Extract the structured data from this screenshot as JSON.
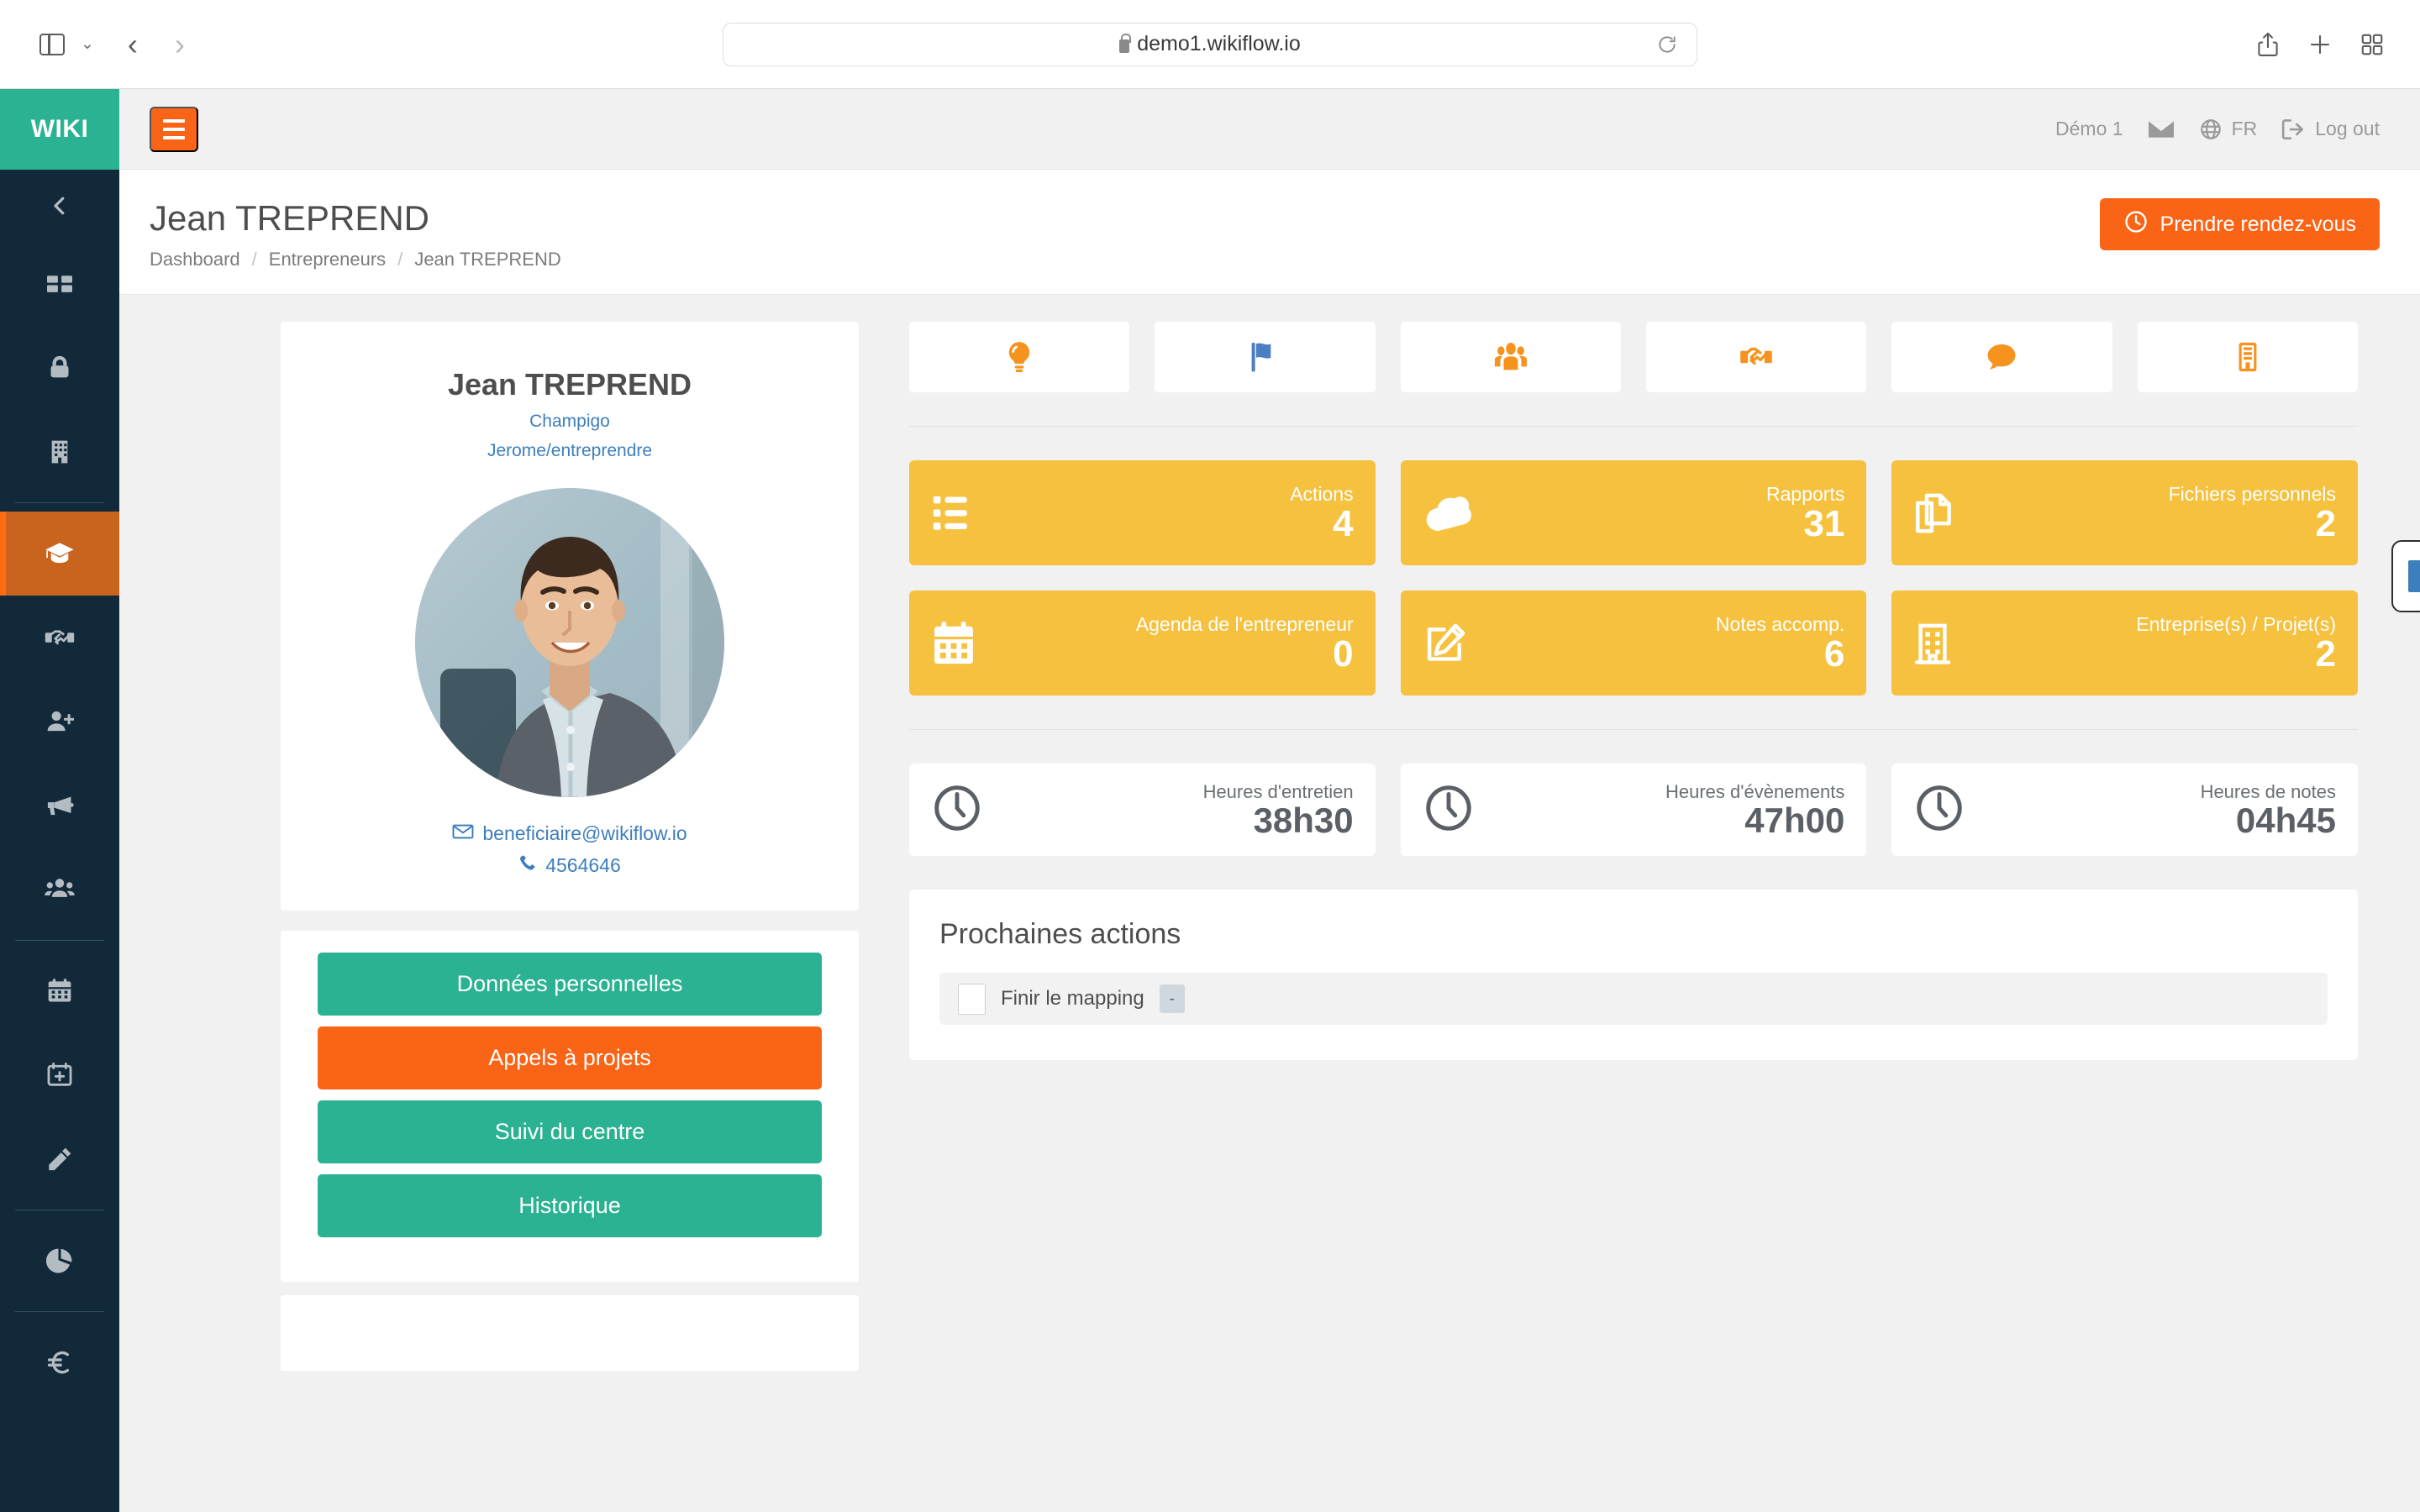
{
  "browser": {
    "url": "demo1.wikiflow.io",
    "icons": {
      "sidebar_toggle": "sidebar-toggle-icon",
      "tab_overview_chevron": "chevron-down-icon",
      "back": "back-arrow-icon",
      "forward": "forward-arrow-icon",
      "shield": "privacy-shield-icon",
      "lock": "lock-icon",
      "reload": "reload-icon",
      "share": "share-icon",
      "new_tab": "plus-icon",
      "tab_grid": "tab-overview-icon"
    },
    "back_glyph": "‹",
    "forward_glyph": "›",
    "chevron_glyph": "⌄"
  },
  "sidebar": {
    "brand": "WIKI",
    "items": [
      {
        "name": "collapse",
        "icon": "chevron-left-icon",
        "active": false,
        "divider_after": false
      },
      {
        "name": "dashboard",
        "icon": "grid-icon",
        "active": false,
        "divider_after": false
      },
      {
        "name": "security",
        "icon": "lock-icon",
        "active": false,
        "divider_after": false
      },
      {
        "name": "companies",
        "icon": "building-icon",
        "active": false,
        "divider_after": true
      },
      {
        "name": "entrepreneurs",
        "icon": "graduation-cap-icon",
        "active": true,
        "divider_after": false
      },
      {
        "name": "partners",
        "icon": "handshake-icon",
        "active": false,
        "divider_after": false
      },
      {
        "name": "add-user",
        "icon": "user-plus-icon",
        "active": false,
        "divider_after": false
      },
      {
        "name": "announcements",
        "icon": "megaphone-icon",
        "active": false,
        "divider_after": false
      },
      {
        "name": "teams",
        "icon": "users-icon",
        "active": false,
        "divider_after": true
      },
      {
        "name": "calendar",
        "icon": "calendar-icon",
        "active": false,
        "divider_after": false
      },
      {
        "name": "add-event",
        "icon": "calendar-plus-icon",
        "active": false,
        "divider_after": false
      },
      {
        "name": "notes",
        "icon": "pencil-icon",
        "active": false,
        "divider_after": true
      },
      {
        "name": "statistics",
        "icon": "pie-chart-icon",
        "active": false,
        "divider_after": true
      },
      {
        "name": "finance",
        "icon": "euro-icon",
        "active": false,
        "divider_after": false
      }
    ]
  },
  "topbar": {
    "menu_icon": "hamburger-menu-icon",
    "account": "Démo 1",
    "mail_icon": "envelope-icon",
    "globe_icon": "globe-icon",
    "language": "FR",
    "logout_icon": "logout-icon",
    "logout": "Log out"
  },
  "page": {
    "title": "Jean TREPREND",
    "breadcrumb": [
      {
        "label": "Dashboard"
      },
      {
        "label": "Entrepreneurs"
      },
      {
        "label": "Jean TREPREND"
      }
    ],
    "breadcrumb_separator": "/",
    "appointment_button": "Prendre rendez-vous",
    "appointment_icon": "clock-icon"
  },
  "profile": {
    "name": "Jean TREPREND",
    "organization": "Champigo",
    "program": "Jerome/entreprendre",
    "email": "beneficiaire@wikiflow.io",
    "email_icon": "envelope-icon",
    "phone": "4564646",
    "phone_icon": "phone-icon",
    "avatar_icon": "profile-photo",
    "actions": [
      {
        "label": "Données personnelles",
        "style": "green"
      },
      {
        "label": "Appels à projets",
        "style": "orange"
      },
      {
        "label": "Suivi du centre",
        "style": "green"
      },
      {
        "label": "Historique",
        "style": "green"
      }
    ]
  },
  "tiles": [
    {
      "name": "idea",
      "icon": "lightbulb-icon",
      "color": "#f6931e"
    },
    {
      "name": "flag",
      "icon": "flag-icon",
      "color": "#4a7fc1"
    },
    {
      "name": "people",
      "icon": "users-icon",
      "color": "#f6931e"
    },
    {
      "name": "partnership",
      "icon": "handshake-icon",
      "color": "#f6931e"
    },
    {
      "name": "comments",
      "icon": "comment-icon",
      "color": "#f6931e"
    },
    {
      "name": "company",
      "icon": "building-icon",
      "color": "#f6931e"
    }
  ],
  "stats": [
    {
      "name": "actions",
      "icon": "list-icon",
      "label": "Actions",
      "value": "4"
    },
    {
      "name": "rapports",
      "icon": "cloud-icon",
      "label": "Rapports",
      "value": "31"
    },
    {
      "name": "fichiers-personnels",
      "icon": "copy-files-icon",
      "label": "Fichiers personnels",
      "value": "2"
    },
    {
      "name": "agenda",
      "icon": "calendar-icon",
      "label": "Agenda de l'entrepreneur",
      "value": "0"
    },
    {
      "name": "notes-accomp",
      "icon": "edit-note-icon",
      "label": "Notes accomp.",
      "value": "6"
    },
    {
      "name": "entreprises-projets",
      "icon": "building-icon",
      "label": "Entreprise(s) / Projet(s)",
      "value": "2"
    }
  ],
  "hours": [
    {
      "name": "heures-entretien",
      "icon": "clock-icon",
      "label": "Heures d'entretien",
      "value": "38h30"
    },
    {
      "name": "heures-evenements",
      "icon": "clock-icon",
      "label": "Heures d'évènements",
      "value": "47h00"
    },
    {
      "name": "heures-notes",
      "icon": "clock-icon",
      "label": "Heures de notes",
      "value": "04h45"
    }
  ],
  "next_actions": {
    "title": "Prochaines actions",
    "items": [
      {
        "label": "Finir le mapping",
        "badge": "-",
        "checked": false
      }
    ]
  },
  "colors": {
    "brand_green": "#2bb292",
    "accent_orange": "#f96416",
    "sidebar_dark": "#12293a",
    "stat_yellow": "#f5c13f",
    "link_blue": "#3d7ebd",
    "tile_orange": "#f6931e",
    "tile_blue": "#4a7fc1"
  }
}
